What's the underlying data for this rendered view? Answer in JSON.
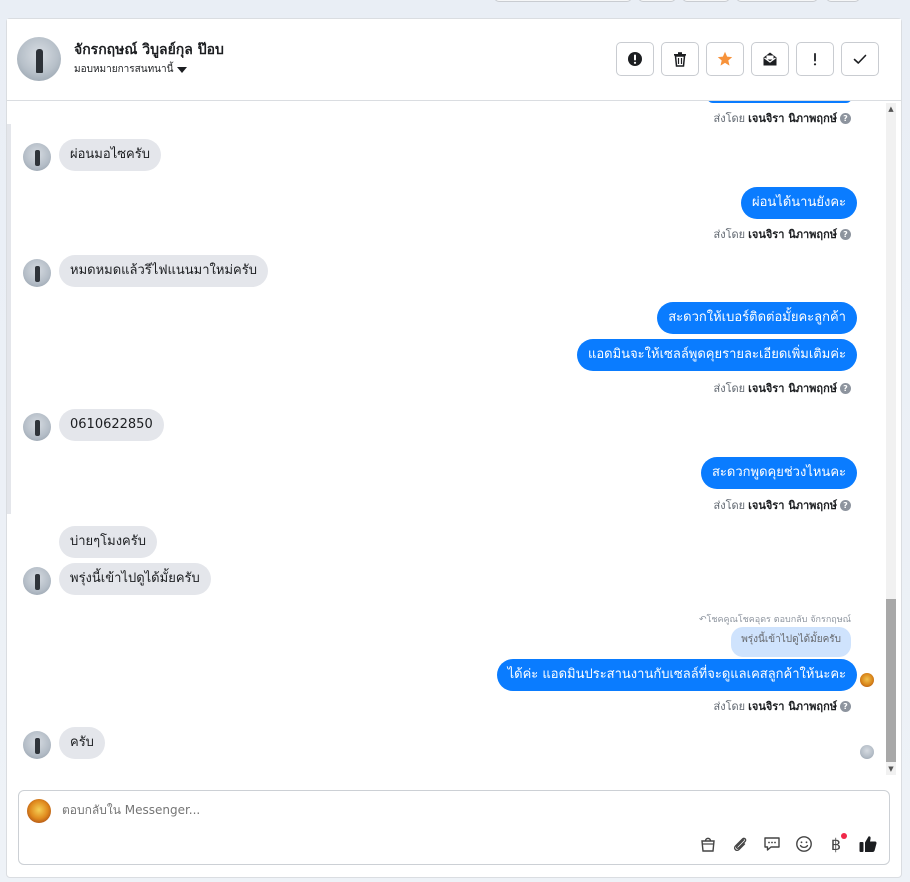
{
  "header": {
    "contact_name": "จักรกฤษณ์ วิบูลย์กุล ป๊อบ",
    "assign_label": "มอบหมายการสนทนานี้",
    "actions": [
      {
        "name": "spam-button",
        "icon": "alert-circle-icon"
      },
      {
        "name": "delete-button",
        "icon": "trash-icon"
      },
      {
        "name": "star-button",
        "icon": "star-icon",
        "color": "#f7923a"
      },
      {
        "name": "mark-unread-button",
        "icon": "envelope-open-icon"
      },
      {
        "name": "follow-up-button",
        "icon": "exclamation-icon"
      },
      {
        "name": "done-button",
        "icon": "check-icon"
      }
    ]
  },
  "sent_by": {
    "prefix": "ส่งโดย",
    "agent": "เจนจิรา นิภาพฤกษ์"
  },
  "messages": [
    {
      "dir": "in",
      "text": "ผ่อนมอไซครับ"
    },
    {
      "dir": "out",
      "text": "ผ่อนได้นานยังคะ"
    },
    {
      "dir": "in",
      "text": "หมดหมดแล้วรีไฟแนนมาใหม่ครับ"
    },
    {
      "dir": "out",
      "text": "สะดวกให้เบอร์ติดต่อมั้ยคะลูกค้า"
    },
    {
      "dir": "out",
      "text": "แอดมินจะให้เซลล์พูดคุยรายละเอียดเพิ่มเติมค่ะ"
    },
    {
      "dir": "in",
      "text": "0610622850"
    },
    {
      "dir": "out",
      "text": "สะดวกพูดคุยช่วงไหนคะ"
    },
    {
      "dir": "in",
      "text": "บ่ายๆโมงครับ"
    },
    {
      "dir": "in",
      "text": "พรุ่งนี้เข้าไปดูได้มั้ยครับ"
    },
    {
      "dir": "out",
      "text": "ได้ค่ะ แอดมินประสานงานกับเซลล์ที่จะดูแลเคสลูกค้าให้นะคะ"
    },
    {
      "dir": "in",
      "text": "ครับ"
    }
  ],
  "reply_context": {
    "note": "โชคคูณโชคอุดร ตอบกลับ จักรกฤษณ์",
    "quoted_text": "พรุ่งนี้เข้าไปดูได้มั้ยครับ"
  },
  "composer": {
    "placeholder": "ตอบกลับใน Messenger...",
    "tools": [
      "bag-icon",
      "paperclip-icon",
      "saved-reply-icon",
      "emoji-icon",
      "baht-icon",
      "thumbs-up-icon"
    ],
    "baht_symbol": "฿"
  },
  "colors": {
    "outgoing_bubble": "#0a7cff",
    "incoming_bubble": "#e4e6eb",
    "star": "#f7923a"
  }
}
